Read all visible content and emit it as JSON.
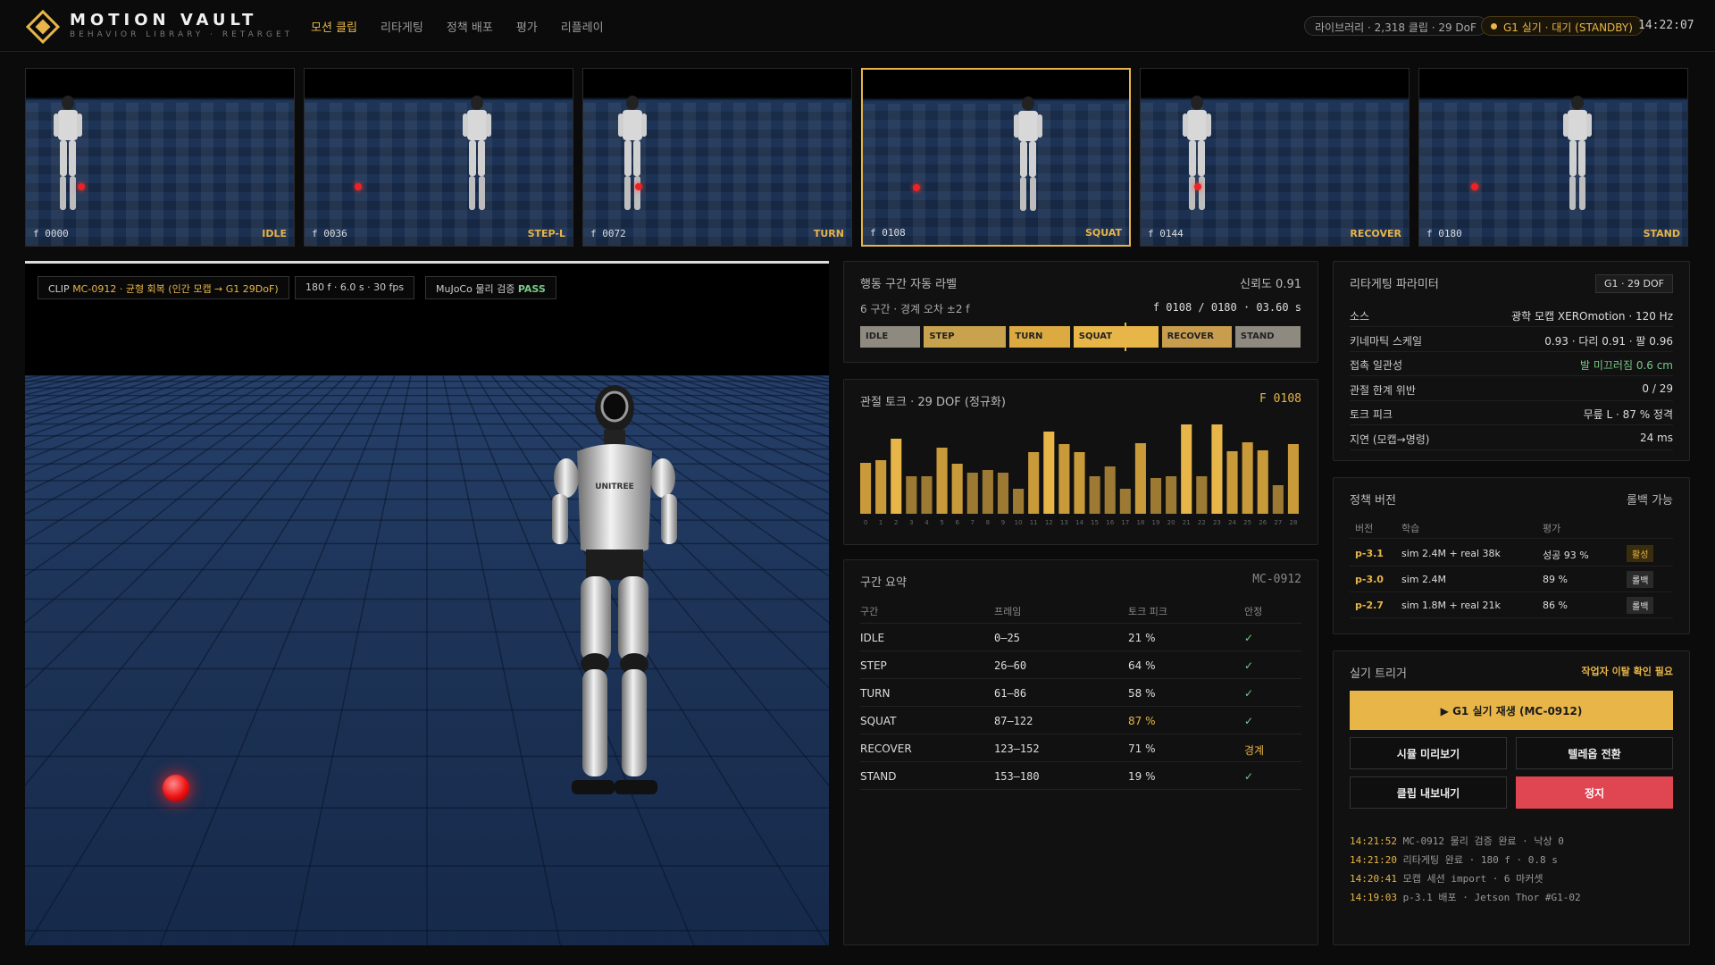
{
  "header": {
    "brand": "MOTION VAULT",
    "brand_sub": "BEHAVIOR LIBRARY · RETARGET",
    "nav": [
      "모션 클립",
      "리타게팅",
      "정책 배포",
      "평가",
      "리플레이"
    ],
    "library_status": "라이브러리 · 2,318 클립 · 29 DoF",
    "robot_status": "G1 실기 · 대기 (STANDBY)",
    "clock": "14:22:07"
  },
  "thumbnails": [
    {
      "frame": "f 0000",
      "label": "IDLE"
    },
    {
      "frame": "f 0036",
      "label": "STEP-L"
    },
    {
      "frame": "f 0072",
      "label": "TURN"
    },
    {
      "frame": "f 0108",
      "label": "SQUAT",
      "selected": true
    },
    {
      "frame": "f 0144",
      "label": "RECOVER"
    },
    {
      "frame": "f 0180",
      "label": "STAND"
    }
  ],
  "viewport": {
    "clip_prefix": "CLIP",
    "clip_id": "MC-0912",
    "clip_desc": "· 균형 회복 (인간 모캡 → G1 29DoF)",
    "clip_meta": "180 f · 6.0 s · 30 fps",
    "physics_label": "MuJoCo 물리 검증",
    "physics_result": "PASS",
    "robot_brand": "UNITREE"
  },
  "segments": {
    "title": "행동 구간 자동 라벨",
    "confidence": "신뢰도 0.91",
    "summary": "6 구간 · 경계 오차 ±2 f",
    "frame_readout": "f 0108 / 0180  ·  03.60 s",
    "cursor_frame": 108,
    "total_frames": 180,
    "items": [
      {
        "label": "IDLE",
        "start": 0,
        "end": 25,
        "color": "#8f8a80"
      },
      {
        "label": "STEP",
        "start": 26,
        "end": 60,
        "color": "#c8a24c"
      },
      {
        "label": "TURN",
        "start": 61,
        "end": 86,
        "color": "#dcaa40"
      },
      {
        "label": "SQUAT",
        "start": 87,
        "end": 122,
        "color": "#e7b548"
      },
      {
        "label": "RECOVER",
        "start": 123,
        "end": 152,
        "color": "#c89e4e"
      },
      {
        "label": "STAND",
        "start": 153,
        "end": 180,
        "color": "#8f8a80"
      }
    ]
  },
  "chart_data": {
    "type": "bar",
    "title": "관절 토크 · 29 DOF (정규화)",
    "frame": "F 0108",
    "categories": [
      "0",
      "1",
      "2",
      "3",
      "4",
      "5",
      "6",
      "7",
      "8",
      "9",
      "10",
      "11",
      "12",
      "13",
      "14",
      "15",
      "16",
      "17",
      "18",
      "19",
      "20",
      "21",
      "22",
      "23",
      "24",
      "25",
      "26",
      "27",
      "28"
    ],
    "values": [
      0.57,
      0.6,
      0.84,
      0.42,
      0.42,
      0.74,
      0.56,
      0.46,
      0.49,
      0.46,
      0.28,
      0.69,
      0.92,
      0.78,
      0.69,
      0.42,
      0.53,
      0.28,
      0.79,
      0.4,
      0.42,
      1.0,
      0.42,
      1.0,
      0.7,
      0.8,
      0.71,
      0.32,
      0.78
    ],
    "ylim": [
      0,
      1
    ]
  },
  "summary": {
    "title": "구간 요약",
    "clip_id": "MC-0912",
    "headers": [
      "구간",
      "프레임",
      "토크 피크",
      "안정"
    ],
    "rows": [
      {
        "seg": "IDLE",
        "frames": "0–25",
        "peak": "21 %",
        "stable": "✓"
      },
      {
        "seg": "STEP",
        "frames": "26–60",
        "peak": "64 %",
        "stable": "✓"
      },
      {
        "seg": "TURN",
        "frames": "61–86",
        "peak": "58 %",
        "stable": "✓"
      },
      {
        "seg": "SQUAT",
        "frames": "87–122",
        "peak": "87 %",
        "stable": "✓",
        "highlight": true
      },
      {
        "seg": "RECOVER",
        "frames": "123–152",
        "peak": "71 %",
        "stable": "경계",
        "warn": true
      },
      {
        "seg": "STAND",
        "frames": "153–180",
        "peak": "19 %",
        "stable": "✓"
      }
    ]
  },
  "retarget": {
    "title": "리타게팅 파라미터",
    "badge": "G1 · 29 DOF",
    "params": [
      {
        "k": "소스",
        "v": "광학 모캡 XEROmotion · 120 Hz"
      },
      {
        "k": "키네마틱 스케일",
        "v": "0.93 · 다리 0.91 · 팔 0.96"
      },
      {
        "k": "접촉 일관성",
        "v": "발 미끄러짐 0.6 cm",
        "ok": true
      },
      {
        "k": "관절 한계 위반",
        "v": "0 / 29"
      },
      {
        "k": "토크 피크",
        "v": "무릎 L · 87 % 정격"
      },
      {
        "k": "지연 (모캡→명령)",
        "v": "24 ms"
      }
    ]
  },
  "policy": {
    "title": "정책 버전",
    "rollback": "롤백 가능",
    "headers": [
      "버전",
      "학습",
      "평가"
    ],
    "rows": [
      {
        "ver": "p-3.1",
        "train": "sim 2.4M + real 38k",
        "eval": "성공 93 %",
        "tag": "활성",
        "active": true
      },
      {
        "ver": "p-3.0",
        "train": "sim 2.4M",
        "eval": "89 %",
        "tag": "롤백"
      },
      {
        "ver": "p-2.7",
        "train": "sim 1.8M + real 21k",
        "eval": "86 %",
        "tag": "롤백"
      }
    ]
  },
  "trigger": {
    "title": "실기 트리거",
    "warning": "작업자 이탈 확인 필요",
    "play": "▶ G1 실기 재생 (MC-0912)",
    "preview": "시뮬 미리보기",
    "teleop": "텔레옵 전환",
    "export": "클립 내보내기",
    "stop": "정지",
    "log": [
      {
        "t": "14:21:52",
        "m": "MC-0912 물리 검증 완료 · 낙상 0"
      },
      {
        "t": "14:21:20",
        "m": "리타게팅 완료 · 180 f · 0.8 s"
      },
      {
        "t": "14:20:41",
        "m": "모캡 세션 import · 6 마커셋"
      },
      {
        "t": "14:19:03",
        "m": "p-3.1 배포 · Jetson Thor #G1-02"
      }
    ]
  },
  "colors": {
    "accent": "#e7b548",
    "danger": "#e04552",
    "ok": "#7ac98a",
    "floor": "#1d3458"
  }
}
